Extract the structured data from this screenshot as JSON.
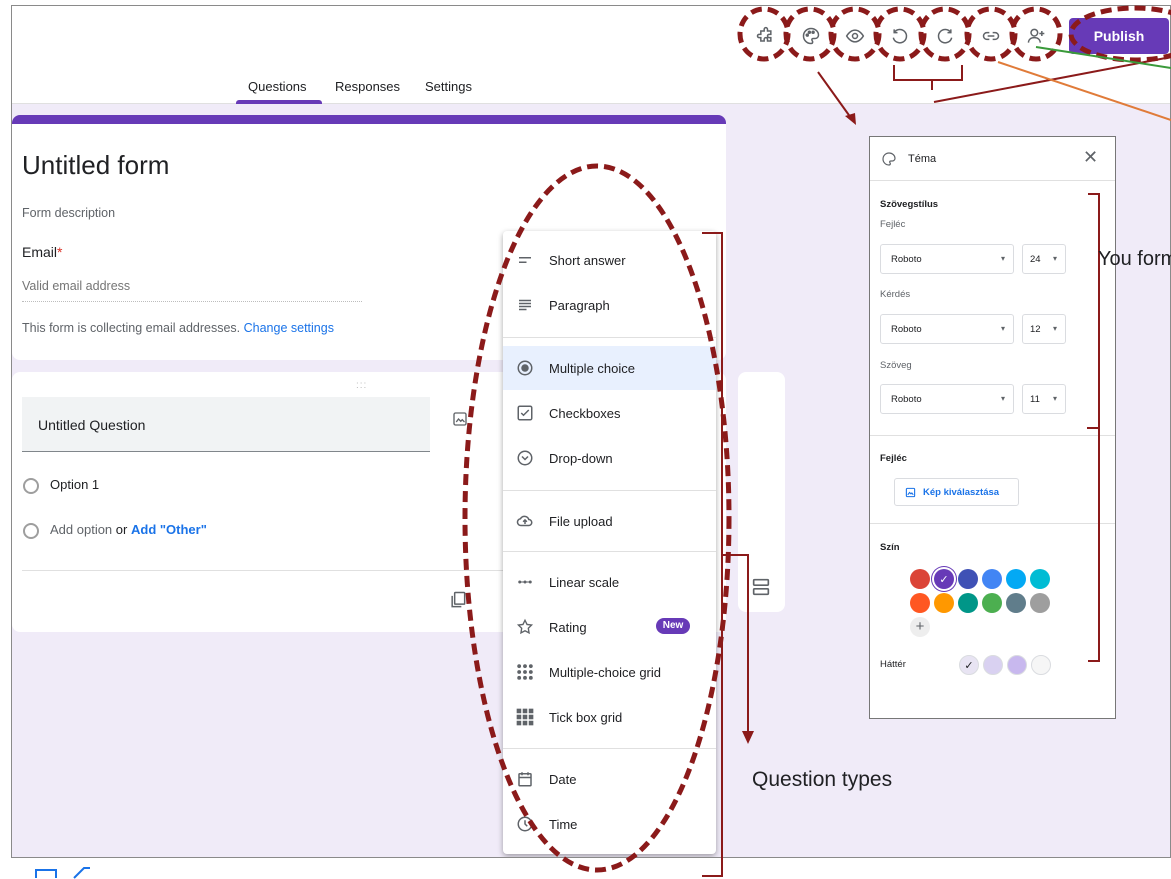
{
  "header": {
    "publish_label": "Publish",
    "tabs": [
      {
        "label": "Questions",
        "active": true
      },
      {
        "label": "Responses",
        "active": false
      },
      {
        "label": "Settings",
        "active": false
      }
    ],
    "icons": [
      "add-ons-icon",
      "palette-icon",
      "preview-eye-icon",
      "undo-icon",
      "redo-icon",
      "link-icon",
      "add-collaborator-icon"
    ]
  },
  "form": {
    "title": "Untitled form",
    "description_placeholder": "Form description",
    "email_label": "Email",
    "required_mark": "*",
    "email_placeholder": "Valid email address",
    "collecting_note": "This form is collecting email addresses.",
    "change_settings": "Change settings"
  },
  "question": {
    "title": "Untitled Question",
    "drag_handle": ":::",
    "option_1": "Option 1",
    "add_option": "Add option",
    "or_word": "or",
    "add_other": "Add \"Other\""
  },
  "type_menu": {
    "items": [
      {
        "label": "Short answer",
        "icon": "short-text-icon"
      },
      {
        "label": "Paragraph",
        "icon": "paragraph-icon"
      },
      {
        "label": "Multiple choice",
        "icon": "radio-button-icon",
        "selected": true
      },
      {
        "label": "Checkboxes",
        "icon": "checkbox-icon"
      },
      {
        "label": "Drop-down",
        "icon": "dropdown-circle-icon"
      },
      {
        "label": "File upload",
        "icon": "cloud-upload-icon"
      },
      {
        "label": "Linear scale",
        "icon": "linear-scale-icon"
      },
      {
        "label": "Rating",
        "icon": "star-icon",
        "badge": "New"
      },
      {
        "label": "Multiple-choice grid",
        "icon": "grid-dots-icon"
      },
      {
        "label": "Tick box grid",
        "icon": "grid-squares-icon"
      },
      {
        "label": "Date",
        "icon": "calendar-icon"
      },
      {
        "label": "Time",
        "icon": "clock-icon"
      }
    ]
  },
  "theme_panel": {
    "title": "Téma",
    "text_style_heading": "Szövegstílus",
    "header_label": "Fejléc",
    "header_font": "Roboto",
    "header_size": "24",
    "question_label": "Kérdés",
    "question_font": "Roboto",
    "question_size": "12",
    "text_label": "Szöveg",
    "text_font": "Roboto",
    "text_size": "11",
    "header_section": "Fejléc",
    "choose_image": "Kép kiválasztása",
    "color_heading": "Szín",
    "colors": [
      "#db4437",
      "#673ab7",
      "#3f51b5",
      "#4285f4",
      "#03a9f4",
      "#00bcd4",
      "#ff5722",
      "#ff9800",
      "#009688",
      "#4caf50",
      "#607d8b",
      "#9e9e9e"
    ],
    "selected_color": "#673ab7",
    "background_label": "Háttér",
    "background_colors": [
      "#e8e4f3",
      "#d9d1f1",
      "#c8b8ee",
      "#f6f6f6"
    ],
    "add_color": "+"
  },
  "annotations": {
    "question_types": "Question types",
    "side_note": "You form imag and size,"
  },
  "accent": "#673ab7",
  "annotation_color": "#8b1a1a"
}
